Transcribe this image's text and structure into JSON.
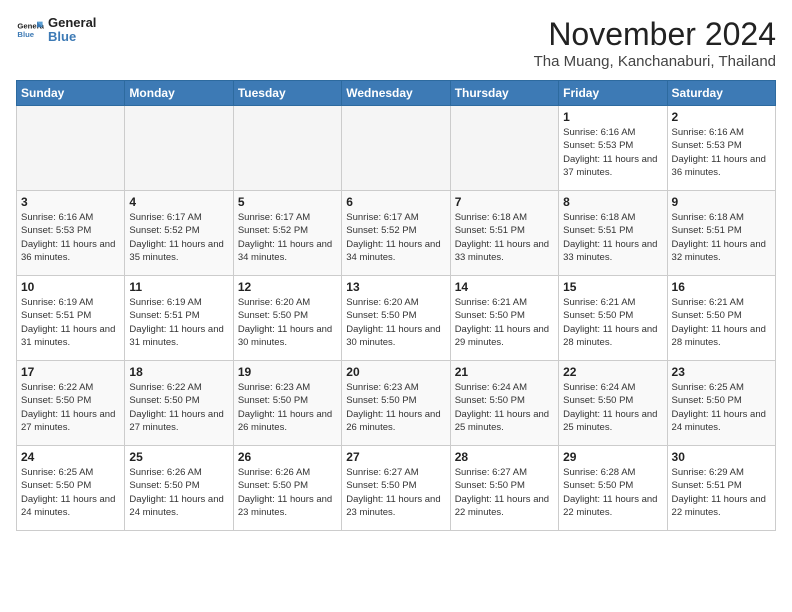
{
  "header": {
    "logo_general": "General",
    "logo_blue": "Blue",
    "month_title": "November 2024",
    "location": "Tha Muang, Kanchanaburi, Thailand"
  },
  "days_of_week": [
    "Sunday",
    "Monday",
    "Tuesday",
    "Wednesday",
    "Thursday",
    "Friday",
    "Saturday"
  ],
  "weeks": [
    [
      {
        "day": "",
        "empty": true
      },
      {
        "day": "",
        "empty": true
      },
      {
        "day": "",
        "empty": true
      },
      {
        "day": "",
        "empty": true
      },
      {
        "day": "",
        "empty": true
      },
      {
        "day": "1",
        "sunrise": "6:16 AM",
        "sunset": "5:53 PM",
        "daylight": "11 hours and 37 minutes."
      },
      {
        "day": "2",
        "sunrise": "6:16 AM",
        "sunset": "5:53 PM",
        "daylight": "11 hours and 36 minutes."
      }
    ],
    [
      {
        "day": "3",
        "sunrise": "6:16 AM",
        "sunset": "5:53 PM",
        "daylight": "11 hours and 36 minutes."
      },
      {
        "day": "4",
        "sunrise": "6:17 AM",
        "sunset": "5:52 PM",
        "daylight": "11 hours and 35 minutes."
      },
      {
        "day": "5",
        "sunrise": "6:17 AM",
        "sunset": "5:52 PM",
        "daylight": "11 hours and 34 minutes."
      },
      {
        "day": "6",
        "sunrise": "6:17 AM",
        "sunset": "5:52 PM",
        "daylight": "11 hours and 34 minutes."
      },
      {
        "day": "7",
        "sunrise": "6:18 AM",
        "sunset": "5:51 PM",
        "daylight": "11 hours and 33 minutes."
      },
      {
        "day": "8",
        "sunrise": "6:18 AM",
        "sunset": "5:51 PM",
        "daylight": "11 hours and 33 minutes."
      },
      {
        "day": "9",
        "sunrise": "6:18 AM",
        "sunset": "5:51 PM",
        "daylight": "11 hours and 32 minutes."
      }
    ],
    [
      {
        "day": "10",
        "sunrise": "6:19 AM",
        "sunset": "5:51 PM",
        "daylight": "11 hours and 31 minutes."
      },
      {
        "day": "11",
        "sunrise": "6:19 AM",
        "sunset": "5:51 PM",
        "daylight": "11 hours and 31 minutes."
      },
      {
        "day": "12",
        "sunrise": "6:20 AM",
        "sunset": "5:50 PM",
        "daylight": "11 hours and 30 minutes."
      },
      {
        "day": "13",
        "sunrise": "6:20 AM",
        "sunset": "5:50 PM",
        "daylight": "11 hours and 30 minutes."
      },
      {
        "day": "14",
        "sunrise": "6:21 AM",
        "sunset": "5:50 PM",
        "daylight": "11 hours and 29 minutes."
      },
      {
        "day": "15",
        "sunrise": "6:21 AM",
        "sunset": "5:50 PM",
        "daylight": "11 hours and 28 minutes."
      },
      {
        "day": "16",
        "sunrise": "6:21 AM",
        "sunset": "5:50 PM",
        "daylight": "11 hours and 28 minutes."
      }
    ],
    [
      {
        "day": "17",
        "sunrise": "6:22 AM",
        "sunset": "5:50 PM",
        "daylight": "11 hours and 27 minutes."
      },
      {
        "day": "18",
        "sunrise": "6:22 AM",
        "sunset": "5:50 PM",
        "daylight": "11 hours and 27 minutes."
      },
      {
        "day": "19",
        "sunrise": "6:23 AM",
        "sunset": "5:50 PM",
        "daylight": "11 hours and 26 minutes."
      },
      {
        "day": "20",
        "sunrise": "6:23 AM",
        "sunset": "5:50 PM",
        "daylight": "11 hours and 26 minutes."
      },
      {
        "day": "21",
        "sunrise": "6:24 AM",
        "sunset": "5:50 PM",
        "daylight": "11 hours and 25 minutes."
      },
      {
        "day": "22",
        "sunrise": "6:24 AM",
        "sunset": "5:50 PM",
        "daylight": "11 hours and 25 minutes."
      },
      {
        "day": "23",
        "sunrise": "6:25 AM",
        "sunset": "5:50 PM",
        "daylight": "11 hours and 24 minutes."
      }
    ],
    [
      {
        "day": "24",
        "sunrise": "6:25 AM",
        "sunset": "5:50 PM",
        "daylight": "11 hours and 24 minutes."
      },
      {
        "day": "25",
        "sunrise": "6:26 AM",
        "sunset": "5:50 PM",
        "daylight": "11 hours and 24 minutes."
      },
      {
        "day": "26",
        "sunrise": "6:26 AM",
        "sunset": "5:50 PM",
        "daylight": "11 hours and 23 minutes."
      },
      {
        "day": "27",
        "sunrise": "6:27 AM",
        "sunset": "5:50 PM",
        "daylight": "11 hours and 23 minutes."
      },
      {
        "day": "28",
        "sunrise": "6:27 AM",
        "sunset": "5:50 PM",
        "daylight": "11 hours and 22 minutes."
      },
      {
        "day": "29",
        "sunrise": "6:28 AM",
        "sunset": "5:50 PM",
        "daylight": "11 hours and 22 minutes."
      },
      {
        "day": "30",
        "sunrise": "6:29 AM",
        "sunset": "5:51 PM",
        "daylight": "11 hours and 22 minutes."
      }
    ]
  ],
  "labels": {
    "sunrise": "Sunrise:",
    "sunset": "Sunset:",
    "daylight": "Daylight:"
  }
}
